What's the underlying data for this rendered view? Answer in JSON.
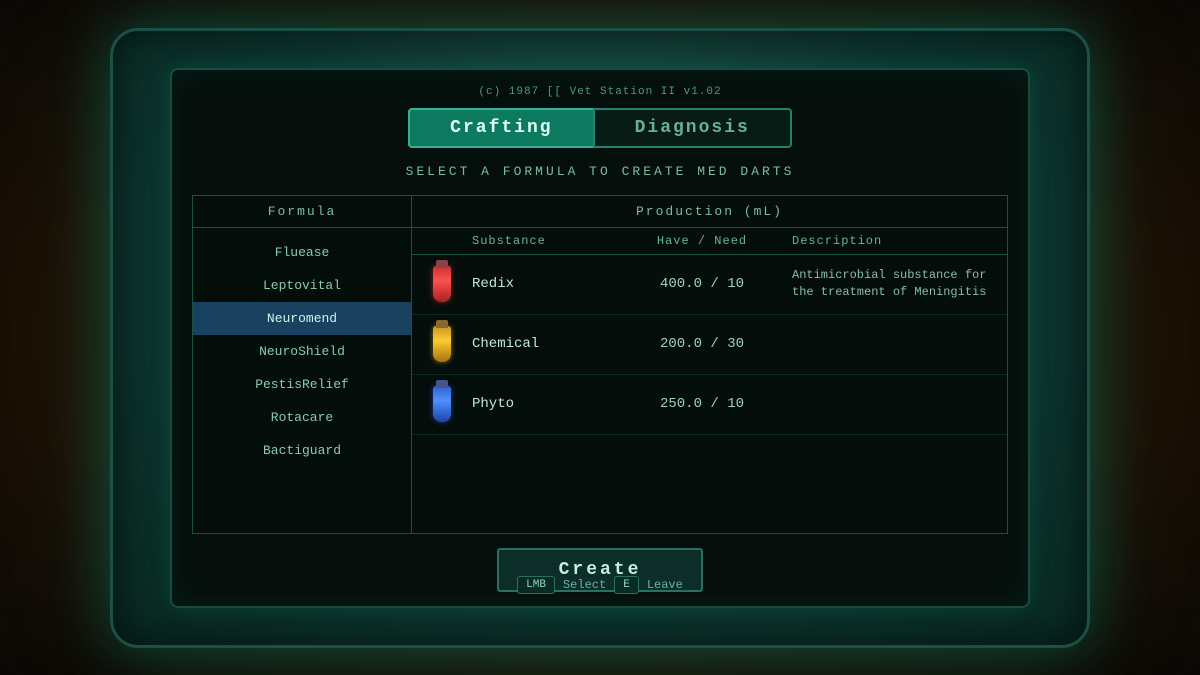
{
  "screen": {
    "copyright": "(c) 1987 [[ Vet Station II v1.02",
    "subtitle": "SELECT A FORMULA TO CREATE MED DARTS"
  },
  "tabs": [
    {
      "id": "crafting",
      "label": "Crafting",
      "active": true
    },
    {
      "id": "diagnosis",
      "label": "Diagnosis",
      "active": false
    }
  ],
  "formula_panel": {
    "header": "Formula",
    "items": [
      {
        "id": "fluease",
        "label": "Fluease",
        "selected": false
      },
      {
        "id": "leptovital",
        "label": "Leptovital",
        "selected": false
      },
      {
        "id": "neuromend",
        "label": "Neuromend",
        "selected": true
      },
      {
        "id": "neuroshield",
        "label": "NeuroShield",
        "selected": false
      },
      {
        "id": "pestisrelief",
        "label": "PestisRelief",
        "selected": false
      },
      {
        "id": "rotacare",
        "label": "Rotacare",
        "selected": false
      },
      {
        "id": "bactiguard",
        "label": "Bactiguard",
        "selected": false
      }
    ]
  },
  "production_panel": {
    "header": "Production (mL)",
    "columns": {
      "substance": "Substance",
      "have_need": "Have / Need",
      "description": "Description"
    },
    "substances": [
      {
        "id": "redix",
        "name": "Redix",
        "vial_color": "red",
        "have": "400.0",
        "slash": "/",
        "need": "10",
        "description": "Antimicrobial substance for the treatment of Meningitis"
      },
      {
        "id": "chemical",
        "name": "Chemical",
        "vial_color": "yellow",
        "have": "200.0",
        "slash": "/",
        "need": "30",
        "description": ""
      },
      {
        "id": "phyto",
        "name": "Phyto",
        "vial_color": "blue",
        "have": "250.0",
        "slash": "/",
        "need": "10",
        "description": ""
      }
    ]
  },
  "buttons": {
    "create": "Create"
  },
  "hotkeys": [
    {
      "key": "LMB",
      "label": "Select"
    },
    {
      "key": "E",
      "label": "Leave"
    }
  ]
}
